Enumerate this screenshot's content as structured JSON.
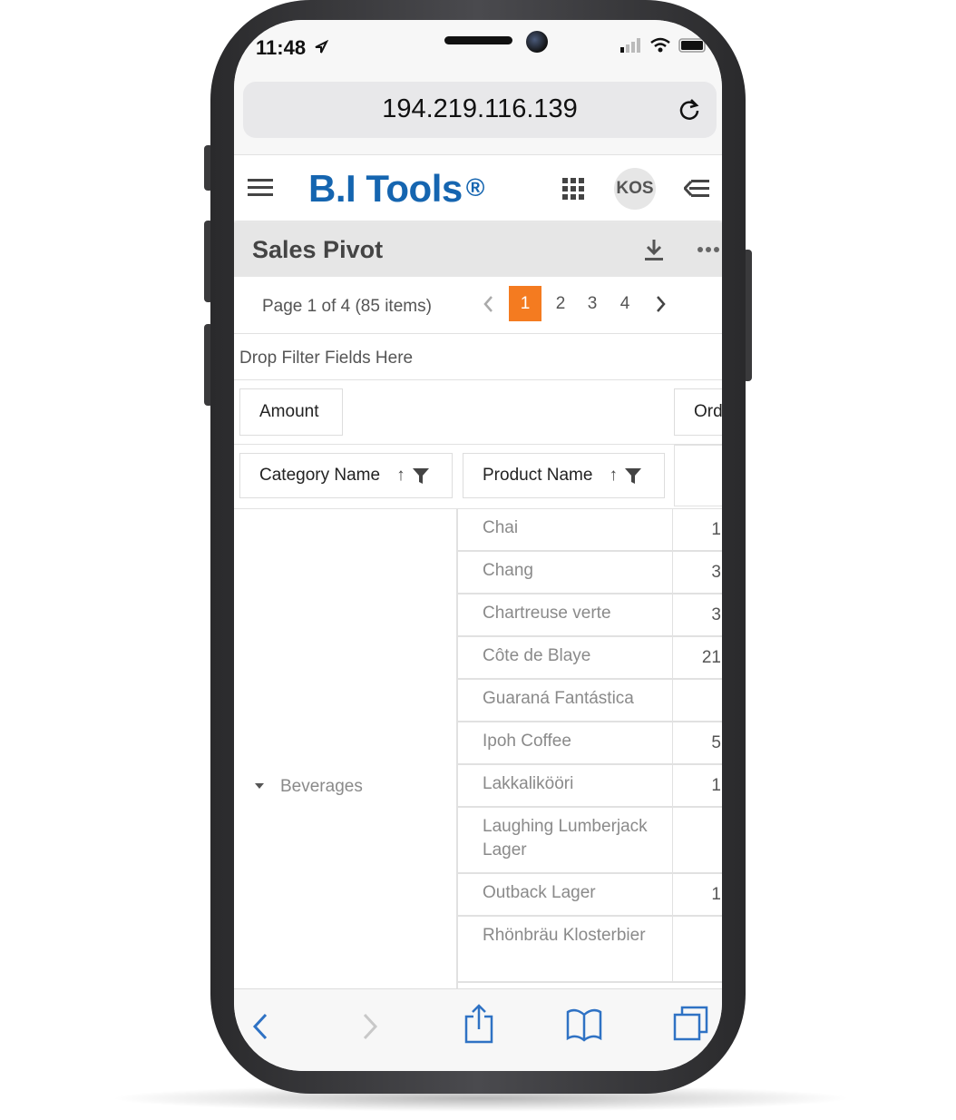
{
  "status_bar": {
    "time": "11:48"
  },
  "browser": {
    "url": "194.219.116.139"
  },
  "app": {
    "logo_part1": "B.I",
    "logo_part2": "Tools",
    "logo_mark": "®",
    "avatar_initials": "KOS"
  },
  "report": {
    "title": "Sales Pivot"
  },
  "pager": {
    "summary": "Page 1 of 4 (85 items)",
    "pages": [
      "1",
      "2",
      "3",
      "4"
    ],
    "current_page": "1",
    "accent_color": "#f47b20"
  },
  "pivot": {
    "filter_drop_text": "Drop Filter Fields Here",
    "value_field": "Amount",
    "column_field": "Ord",
    "row_fields": [
      "Category Name",
      "Product Name"
    ],
    "category": "Beverages",
    "rows": [
      {
        "product": "Chai",
        "value": "1"
      },
      {
        "product": "Chang",
        "value": "3"
      },
      {
        "product": "Chartreuse verte",
        "value": "3"
      },
      {
        "product": "Côte de Blaye",
        "value": "21"
      },
      {
        "product": "Guaraná Fantástica",
        "value": ""
      },
      {
        "product": "Ipoh Coffee",
        "value": "5"
      },
      {
        "product": "Lakkalikööri",
        "value": "1"
      },
      {
        "product": "Laughing Lumberjack Lager",
        "value": ""
      },
      {
        "product": "Outback Lager",
        "value": "1"
      },
      {
        "product": "Rhönbräu Klosterbier",
        "value": ""
      }
    ]
  },
  "icons": {
    "menu": "hamburger-icon",
    "apps": "grid-icon",
    "collapse": "collapse-menu-icon",
    "download": "download-icon",
    "more": "more-icon",
    "reload": "reload-icon"
  }
}
